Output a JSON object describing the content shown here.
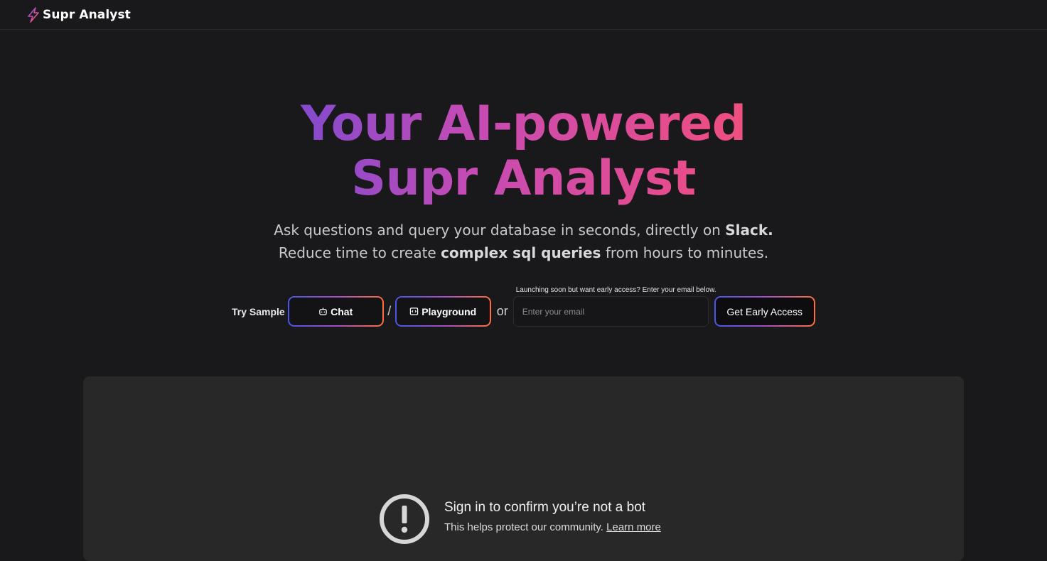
{
  "header": {
    "brand_name": "Supr Analyst",
    "brand_icon": "lightning-bolt-icon"
  },
  "hero": {
    "title_line1_word1": "Your",
    "title_line1_word2": "AI-powered",
    "title_line2_word1": "Supr",
    "title_line2_word2": "Analyst",
    "subtitle_line1_prefix": "Ask questions and query your database in seconds, directly on ",
    "subtitle_line1_bold": "Slack.",
    "subtitle_line2_prefix": "Reduce time to create ",
    "subtitle_line2_bold": "complex sql queries",
    "subtitle_line2_suffix": " from hours to minutes.",
    "gradient_colors": [
      "#3b4be0",
      "#c54bb5",
      "#ec4d86",
      "#ff6e3c"
    ]
  },
  "cta": {
    "try_label": "Try Sample",
    "chat_label": "Chat",
    "chat_icon": "bot-icon",
    "slash": "/",
    "playground_label": "Playground",
    "playground_icon": "code-window-icon",
    "or_label": "or",
    "email_hint": "Launching soon but want early access? Enter your email below.",
    "email_placeholder": "Enter your email",
    "early_access_label": "Get Early Access"
  },
  "video_notice": {
    "icon": "alert-circle-icon",
    "title": "Sign in to confirm you’re not a bot",
    "subtitle_prefix": "This helps protect our community. ",
    "link_label": "Learn more"
  }
}
